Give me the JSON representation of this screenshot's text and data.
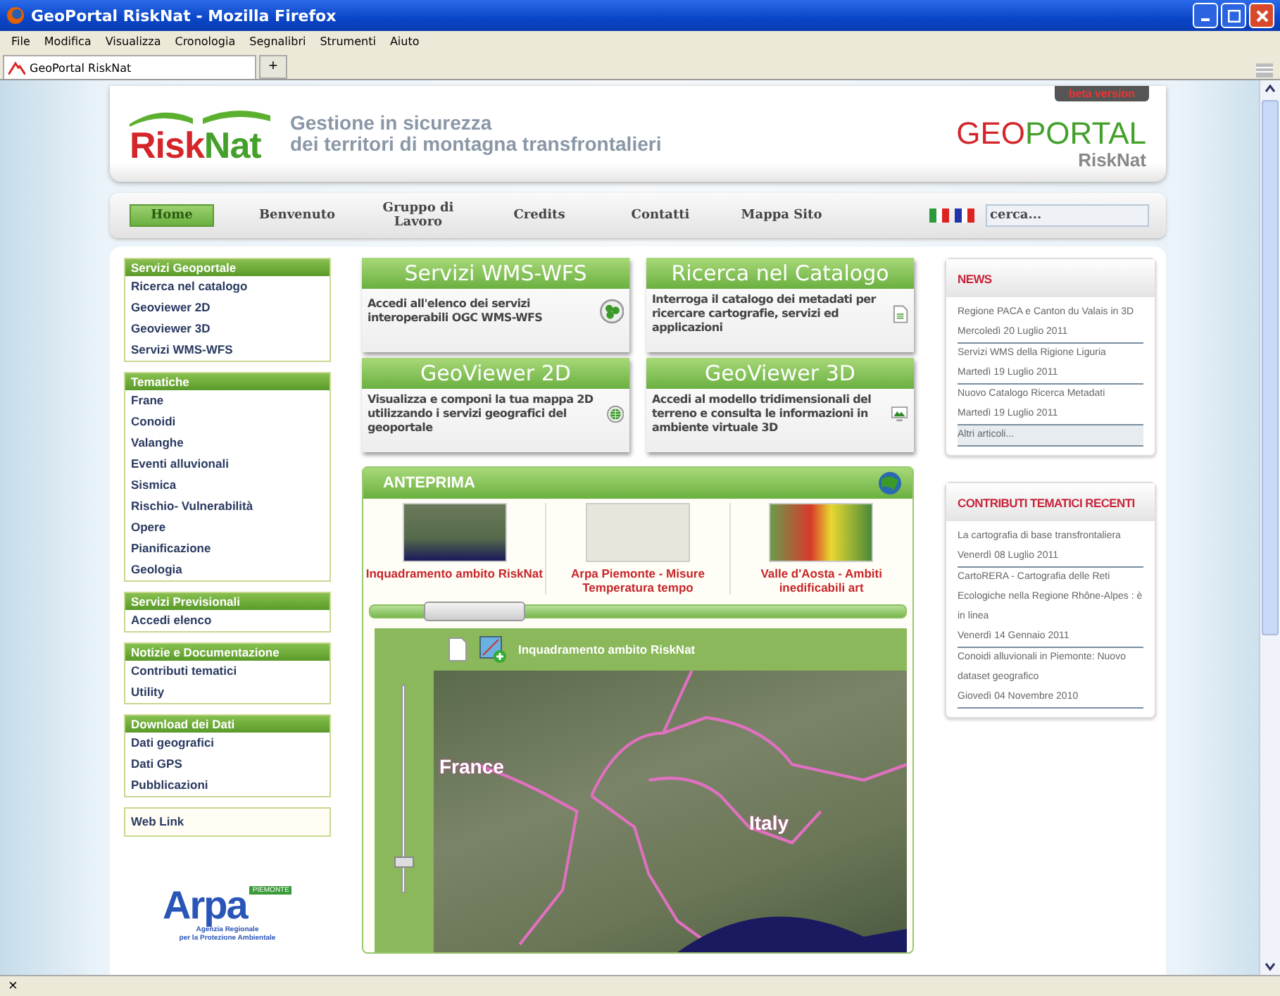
{
  "window": {
    "title": "GeoPortal RiskNat - Mozilla Firefox"
  },
  "menu": [
    "File",
    "Modifica",
    "Visualizza",
    "Cronologia",
    "Segnalibri",
    "Strumenti",
    "Aiuto"
  ],
  "tabs": [
    {
      "label": "GeoPortal RiskNat",
      "selected": true
    }
  ],
  "new_tab": "+",
  "header": {
    "logo_parts": [
      "Risk",
      "Nat"
    ],
    "tagline": [
      "Gestione in sicurezza",
      "dei territori di montagna transfrontalieri"
    ],
    "portal_logo_parts": [
      "GEO",
      "PORTAL"
    ],
    "portal_subtitle": "RiskNat",
    "badge": "beta version"
  },
  "nav": {
    "items": [
      {
        "label": "Home",
        "selected": true
      },
      {
        "label": "Benvenuto",
        "selected": false
      },
      {
        "label": "Gruppo di Lavoro",
        "selected": false
      },
      {
        "label": "Credits",
        "selected": false
      },
      {
        "label": "Contatti",
        "selected": false
      },
      {
        "label": "Mappa Sito",
        "selected": false
      }
    ],
    "search": {
      "placeholder": "cerca..."
    }
  },
  "sidebar": [
    {
      "kind": "menu",
      "title": "Servizi Geoportale",
      "items": [
        "Ricerca nel catalogo",
        "Geoviewer 2D",
        "Geoviewer 3D",
        "Servizi WMS-WFS"
      ]
    },
    {
      "kind": "menu",
      "title": "Tematiche",
      "items": [
        "Frane",
        "Conoidi",
        "Valanghe",
        "Eventi alluvionali",
        "Sismica",
        "Rischio- Vulnerabilità",
        "Opere",
        "Pianificazione",
        "Geologia"
      ]
    },
    {
      "kind": "menu",
      "title": "Servizi Previsionali",
      "items": [
        "Accedi elenco"
      ]
    },
    {
      "kind": "menu",
      "title": "Notizie e Documentazione",
      "items": [
        "Contributi tematici",
        "Utility"
      ]
    },
    {
      "kind": "menu",
      "title": "Download dei Dati",
      "items": [
        "Dati geografici",
        "Dati GPS",
        "Pubblicazioni"
      ]
    },
    {
      "kind": "link",
      "title": "Web Link"
    }
  ],
  "partner_logo": {
    "name": "Arpa",
    "region": "PIEMONTE",
    "caption": [
      "Agenzia Regionale",
      "per la Protezione Ambientale"
    ]
  },
  "cards": [
    {
      "title": "Servizi WMS-WFS",
      "text": "Accedi all'elenco dei servizi interoperabili OGC WMS-WFS"
    },
    {
      "title": "Ricerca nel Catalogo",
      "text": "Interroga il catalogo dei metadati per ricercare cartografie, servizi ed applicazioni"
    },
    {
      "title": "GeoViewer 2D",
      "text": "Visualizza e componi la tua mappa 2D utilizzando i servizi geografici del geoportale"
    },
    {
      "title": "GeoViewer 3D",
      "text": "Accedi al modello tridimensionali del terreno e consulta le informazioni in ambiente virtuale 3D"
    }
  ],
  "preview": {
    "title": "ANTEPRIMA",
    "items": [
      {
        "caption": "Inquadramento ambito RiskNat"
      },
      {
        "caption": "Arpa Piemonte - Misure Temperatura tempo"
      },
      {
        "caption": "Valle d'Aosta - Ambiti inedificabili art"
      }
    ],
    "scroll": {
      "level": 0.1
    }
  },
  "viewer": {
    "title": "Inquadramento ambito RiskNat",
    "zoom": {
      "level": 0.12
    },
    "labels": [
      "France",
      "Italy"
    ]
  },
  "news": {
    "title": "NEWS",
    "items": [
      {
        "text": "Regione PACA e Canton du Valais in 3D",
        "date": "Mercoledì 20 Luglio 2011"
      },
      {
        "text": "Servizi WMS della Rigione Liguria",
        "date": "Martedì 19 Luglio 2011"
      },
      {
        "text": "Nuovo Catalogo Ricerca Metadati",
        "date": "Martedì 19 Luglio 2011"
      }
    ],
    "more": "Altri articoli..."
  },
  "contributions": {
    "title": "CONTRIBUTI TEMATICI RECENTI",
    "items": [
      {
        "text": "La cartografia di base transfrontaliera",
        "date": "Venerdì 08 Luglio 2011"
      },
      {
        "text": "CartoRERA - Cartografia delle Reti Ecologiche nella Regione Rhône-Alpes : è in linea",
        "date": "Venerdì 14 Gennaio 2011"
      },
      {
        "text": "Conoidi alluvionali in Piemonte: Nuovo dataset geografico",
        "date": "Giovedì 04 Novembre 2010"
      }
    ]
  },
  "status_bar": {
    "close": "×"
  }
}
